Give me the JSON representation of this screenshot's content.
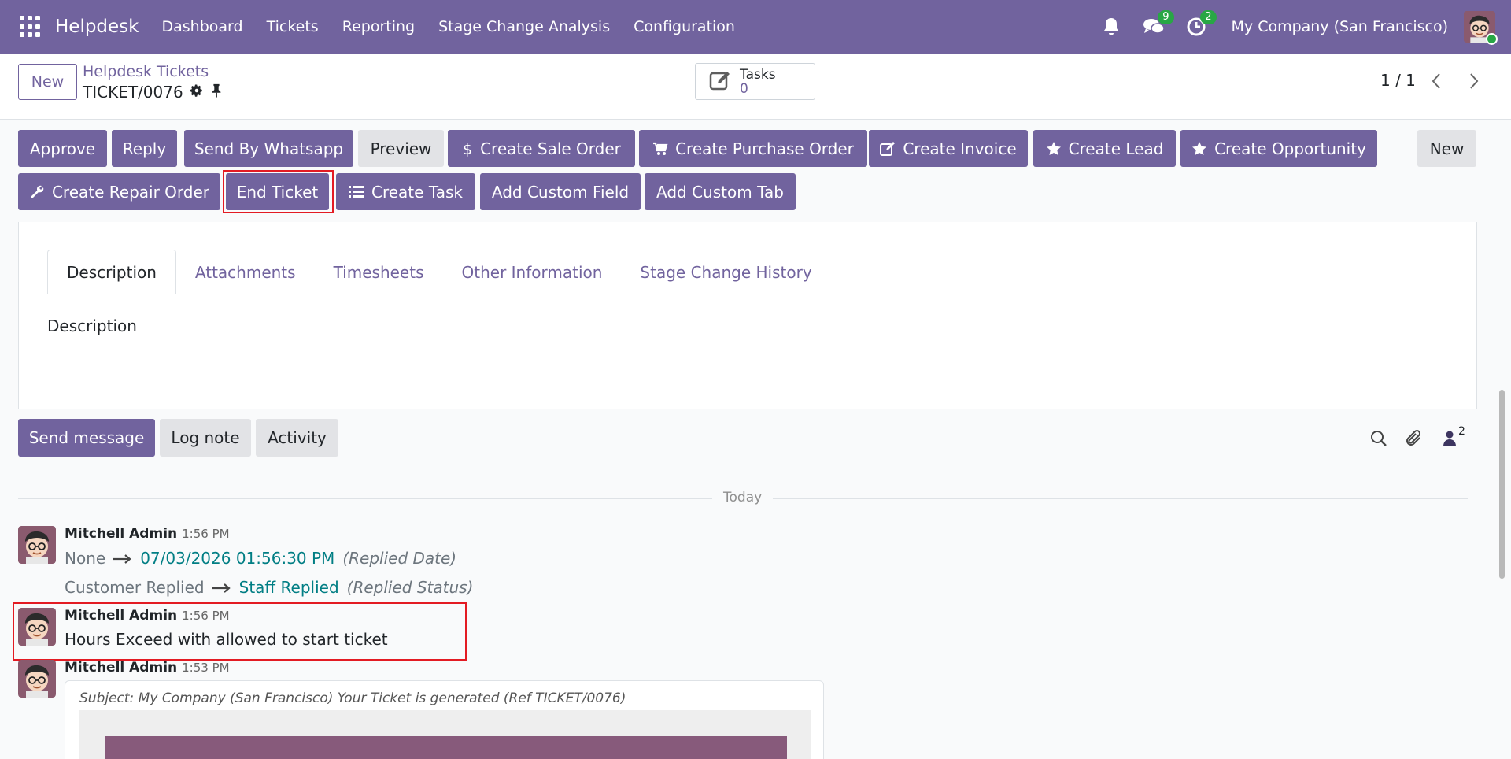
{
  "navbar": {
    "app_name": "Helpdesk",
    "menu": [
      "Dashboard",
      "Tickets",
      "Reporting",
      "Stage Change Analysis",
      "Configuration"
    ],
    "messages_count": "9",
    "activities_count": "2",
    "company": "My Company (San Francisco)"
  },
  "control": {
    "new_label": "New",
    "breadcrumb_parent": "Helpdesk Tickets",
    "record_name": "TICKET/0076",
    "tasks_label": "Tasks",
    "tasks_count": "0",
    "pager": "1 / 1"
  },
  "actions": {
    "approve": "Approve",
    "reply": "Reply",
    "send_whatsapp": "Send By Whatsapp",
    "preview": "Preview",
    "create_sale_order": "Create Sale Order",
    "create_purchase_order": "Create Purchase Order",
    "create_invoice": "Create Invoice",
    "create_lead": "Create Lead",
    "create_opportunity": "Create Opportunity",
    "new": "New",
    "create_repair_order": "Create Repair Order",
    "end_ticket": "End Ticket",
    "create_task": "Create Task",
    "add_custom_field": "Add Custom Field",
    "add_custom_tab": "Add Custom Tab"
  },
  "tabs": [
    "Description",
    "Attachments",
    "Timesheets",
    "Other Information",
    "Stage Change History"
  ],
  "description_label": "Description",
  "chatter": {
    "send_message": "Send message",
    "log_note": "Log note",
    "activity": "Activity",
    "followers_count": "2",
    "date_separator": "Today",
    "messages": [
      {
        "author": "Mitchell Admin",
        "time": "1:56 PM",
        "tracking": [
          {
            "old": "None",
            "new": "07/03/2026 01:56:30 PM",
            "field": "(Replied Date)"
          },
          {
            "old": "Customer Replied",
            "new": "Staff Replied",
            "field": "(Replied Status)"
          }
        ]
      },
      {
        "author": "Mitchell Admin",
        "time": "1:56 PM",
        "body": "Hours Exceed with allowed to start ticket"
      },
      {
        "author": "Mitchell Admin",
        "time": "1:53 PM",
        "subject": "Subject: My Company (San Francisco) Your Ticket is generated (Ref TICKET/0076)"
      }
    ]
  },
  "colors": {
    "brand": "#71639e",
    "highlight": "#e31b23",
    "tracking_value": "#017e84",
    "badge": "#28a745"
  }
}
